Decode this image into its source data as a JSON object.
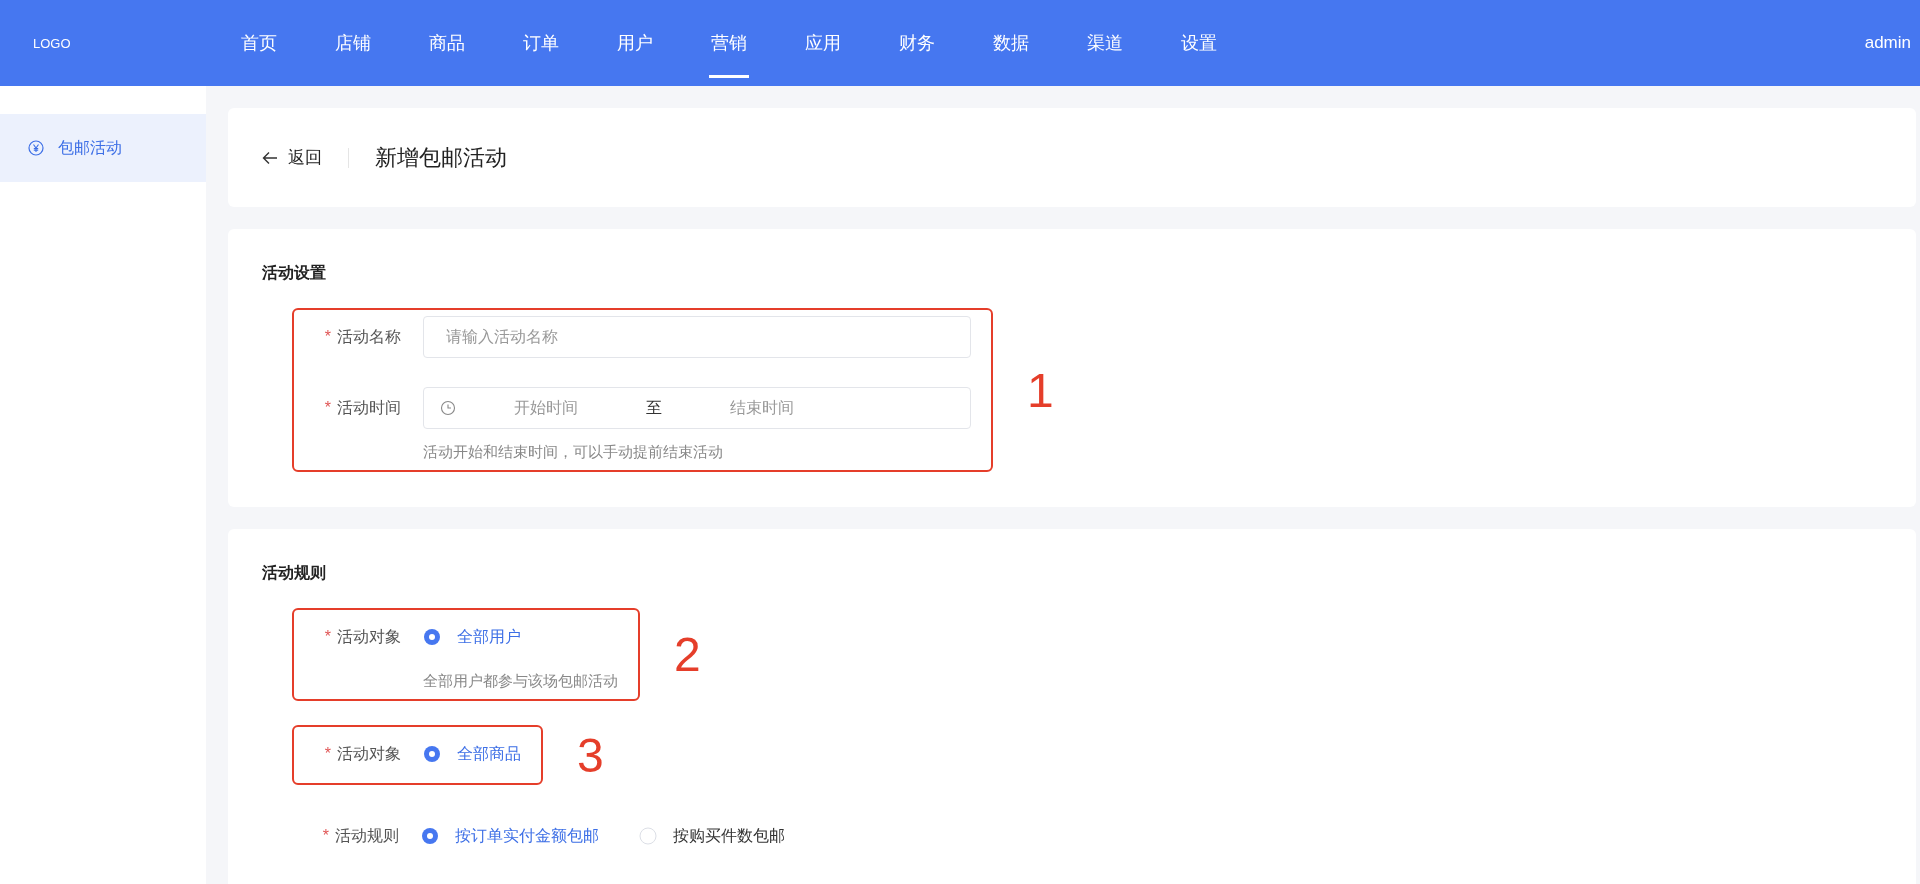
{
  "header": {
    "logo": "LOGO",
    "nav": [
      {
        "label": "首页",
        "selected": false
      },
      {
        "label": "店铺",
        "selected": false
      },
      {
        "label": "商品",
        "selected": false
      },
      {
        "label": "订单",
        "selected": false
      },
      {
        "label": "用户",
        "selected": false
      },
      {
        "label": "营销",
        "selected": true
      },
      {
        "label": "应用",
        "selected": false
      },
      {
        "label": "财务",
        "selected": false
      },
      {
        "label": "数据",
        "selected": false
      },
      {
        "label": "渠道",
        "selected": false
      },
      {
        "label": "设置",
        "selected": false
      }
    ],
    "user": "admin"
  },
  "sidebar": {
    "items": [
      {
        "label": "包邮活动",
        "selected": true
      }
    ]
  },
  "page_header": {
    "back": "返回",
    "title": "新增包邮活动"
  },
  "sections": [
    {
      "title": "活动设置",
      "groups": [
        {
          "annotation": "1",
          "fields": [
            {
              "kind": "input",
              "required_mark": "*",
              "label": "活动名称",
              "placeholder": "请输入活动名称"
            },
            {
              "kind": "daterange",
              "required_mark": "*",
              "label": "活动时间",
              "start_placeholder": "开始时间",
              "separator": "至",
              "end_placeholder": "结束时间",
              "hint": "活动开始和结束时间，可以手动提前结束活动"
            }
          ]
        }
      ]
    },
    {
      "title": "活动规则",
      "groups": [
        {
          "annotation": "2",
          "fields": [
            {
              "kind": "radio",
              "required_mark": "*",
              "label": "活动对象",
              "options": [
                {
                  "label": "全部用户",
                  "selected": true
                }
              ],
              "hint": "全部用户都参与该场包邮活动"
            }
          ]
        },
        {
          "annotation": "3",
          "fields": [
            {
              "kind": "radio",
              "required_mark": "*",
              "label": "活动对象",
              "options": [
                {
                  "label": "全部商品",
                  "selected": true
                }
              ]
            }
          ]
        },
        {
          "fields": [
            {
              "kind": "radio",
              "required_mark": "*",
              "label": "活动规则",
              "options": [
                {
                  "label": "按订单实付金额包邮",
                  "selected": true
                },
                {
                  "label": "按购买件数包邮",
                  "selected": false
                }
              ]
            }
          ]
        }
      ]
    }
  ]
}
